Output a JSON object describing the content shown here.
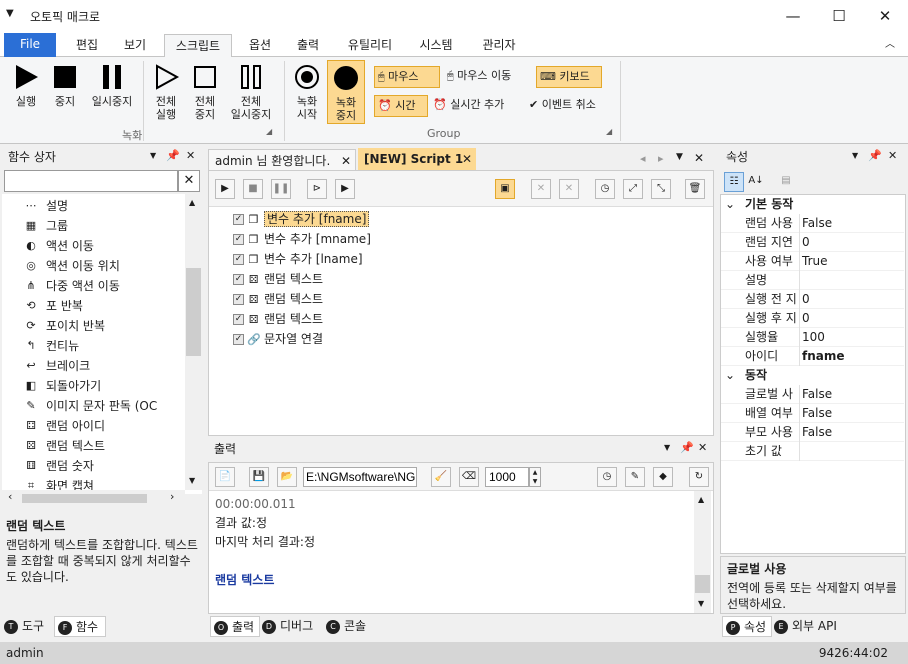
{
  "app": {
    "title": "오토픽 매크로"
  },
  "ribbon_tabs": [
    "File",
    "편집",
    "보기",
    "스크립트",
    "옵션",
    "출력",
    "유틸리티",
    "시스템",
    "관리자"
  ],
  "ribbon": {
    "run": "실행",
    "stop": "중지",
    "pause": "일시중지",
    "all_run": [
      "전체",
      "실행"
    ],
    "all_stop": [
      "전체",
      "중지"
    ],
    "all_pause": [
      "전체",
      "일시중지"
    ],
    "rec_start": [
      "녹화",
      "시작"
    ],
    "rec_stop": [
      "녹화",
      "중지"
    ],
    "mouse": "마우스",
    "mouse_move": "마우스 이동",
    "keyboard": "키보드",
    "time": "시간",
    "realtime_add": "실시간 추가",
    "event_cancel": "이벤트 취소",
    "group_record": "녹화",
    "group_group": "Group"
  },
  "left_panel": {
    "title": "함수 상자",
    "search_value": "",
    "items": [
      "설명",
      "그룹",
      "액션 이동",
      "액션 이동 위치",
      "다중 액션 이동",
      "포 반복",
      "포이치 반복",
      "컨티뉴",
      "브레이크",
      "되돌아가기",
      "이미지 문자 판독 (OC",
      "랜덤 아이디",
      "랜덤 텍스트",
      "랜덤 숫자",
      "화면 캡쳐"
    ],
    "icons": [
      "dots-icon",
      "stack-icon",
      "action-move-icon",
      "target-icon",
      "multi-move-icon",
      "loop-icon",
      "foreach-icon",
      "continue-icon",
      "break-icon",
      "return-icon",
      "ocr-icon",
      "random-id-icon",
      "random-text-icon",
      "random-number-icon",
      "screenshot-icon"
    ],
    "desc_title": "랜덤 텍스트",
    "desc_body": "랜덤하게 텍스트를 조합합니다. 텍스트를 조합할 때 중복되지 않게 처리할수도 있습니다.",
    "tabs": [
      "도구",
      "함수"
    ],
    "tab_letters": [
      "T",
      "F"
    ]
  },
  "editor": {
    "tabs": [
      "admin 님 환영합니다.",
      "[NEW] Script 1"
    ],
    "items": [
      {
        "text": "변수 추가 [fname]",
        "icon": "cube-icon",
        "selected": true
      },
      {
        "text": "변수 추가 [mname]",
        "icon": "cube-icon",
        "selected": false
      },
      {
        "text": "변수 추가 [lname]",
        "icon": "cube-icon",
        "selected": false
      },
      {
        "text": "랜덤 텍스트",
        "icon": "random-text-icon",
        "selected": false
      },
      {
        "text": "랜덤 텍스트",
        "icon": "random-text-icon",
        "selected": false
      },
      {
        "text": "랜덤 텍스트",
        "icon": "random-text-icon",
        "selected": false
      },
      {
        "text": "문자열 연결",
        "icon": "link-icon",
        "selected": false
      }
    ]
  },
  "output": {
    "title": "출력",
    "path": "E:\\NGMsoftware\\NG",
    "count": "1000",
    "lines": [
      "00:00:00.011",
      "결과 값:정",
      "마지막 처리 결과:정",
      "",
      "랜덤 텍스트"
    ],
    "tabs": [
      "출력",
      "디버그",
      "콘솔"
    ],
    "tab_letters": [
      "O",
      "D",
      "C"
    ]
  },
  "properties": {
    "title": "속성",
    "cat1": "기본 동작",
    "rows1": [
      {
        "k": "랜덤 사용",
        "v": "False"
      },
      {
        "k": "랜덤 지연",
        "v": "0"
      },
      {
        "k": "사용 여부",
        "v": "True"
      },
      {
        "k": "설명",
        "v": ""
      },
      {
        "k": "실행 전 지",
        "v": "0"
      },
      {
        "k": "실행 후 지",
        "v": "0"
      },
      {
        "k": "실행율",
        "v": "100"
      },
      {
        "k": "아이디",
        "v": "fname"
      }
    ],
    "cat2": "동작",
    "rows2": [
      {
        "k": "글로벌 사",
        "v": "False"
      },
      {
        "k": "배열 여부",
        "v": "False"
      },
      {
        "k": "부모 사용",
        "v": "False"
      },
      {
        "k": "초기 값",
        "v": ""
      }
    ],
    "desc_title": "글로벌 사용",
    "desc_body": "전역에 등록 또는 삭제할지 여부를 선택하세요.",
    "tabs": [
      "속성",
      "외부 API"
    ],
    "tab_letters": [
      "P",
      "E"
    ]
  },
  "status": {
    "user": "admin",
    "time": "9426:44:02"
  },
  "colors": {
    "accent": "#2b6fd6",
    "highlight": "#fcd992",
    "highlight_border": "#e3a82a"
  }
}
